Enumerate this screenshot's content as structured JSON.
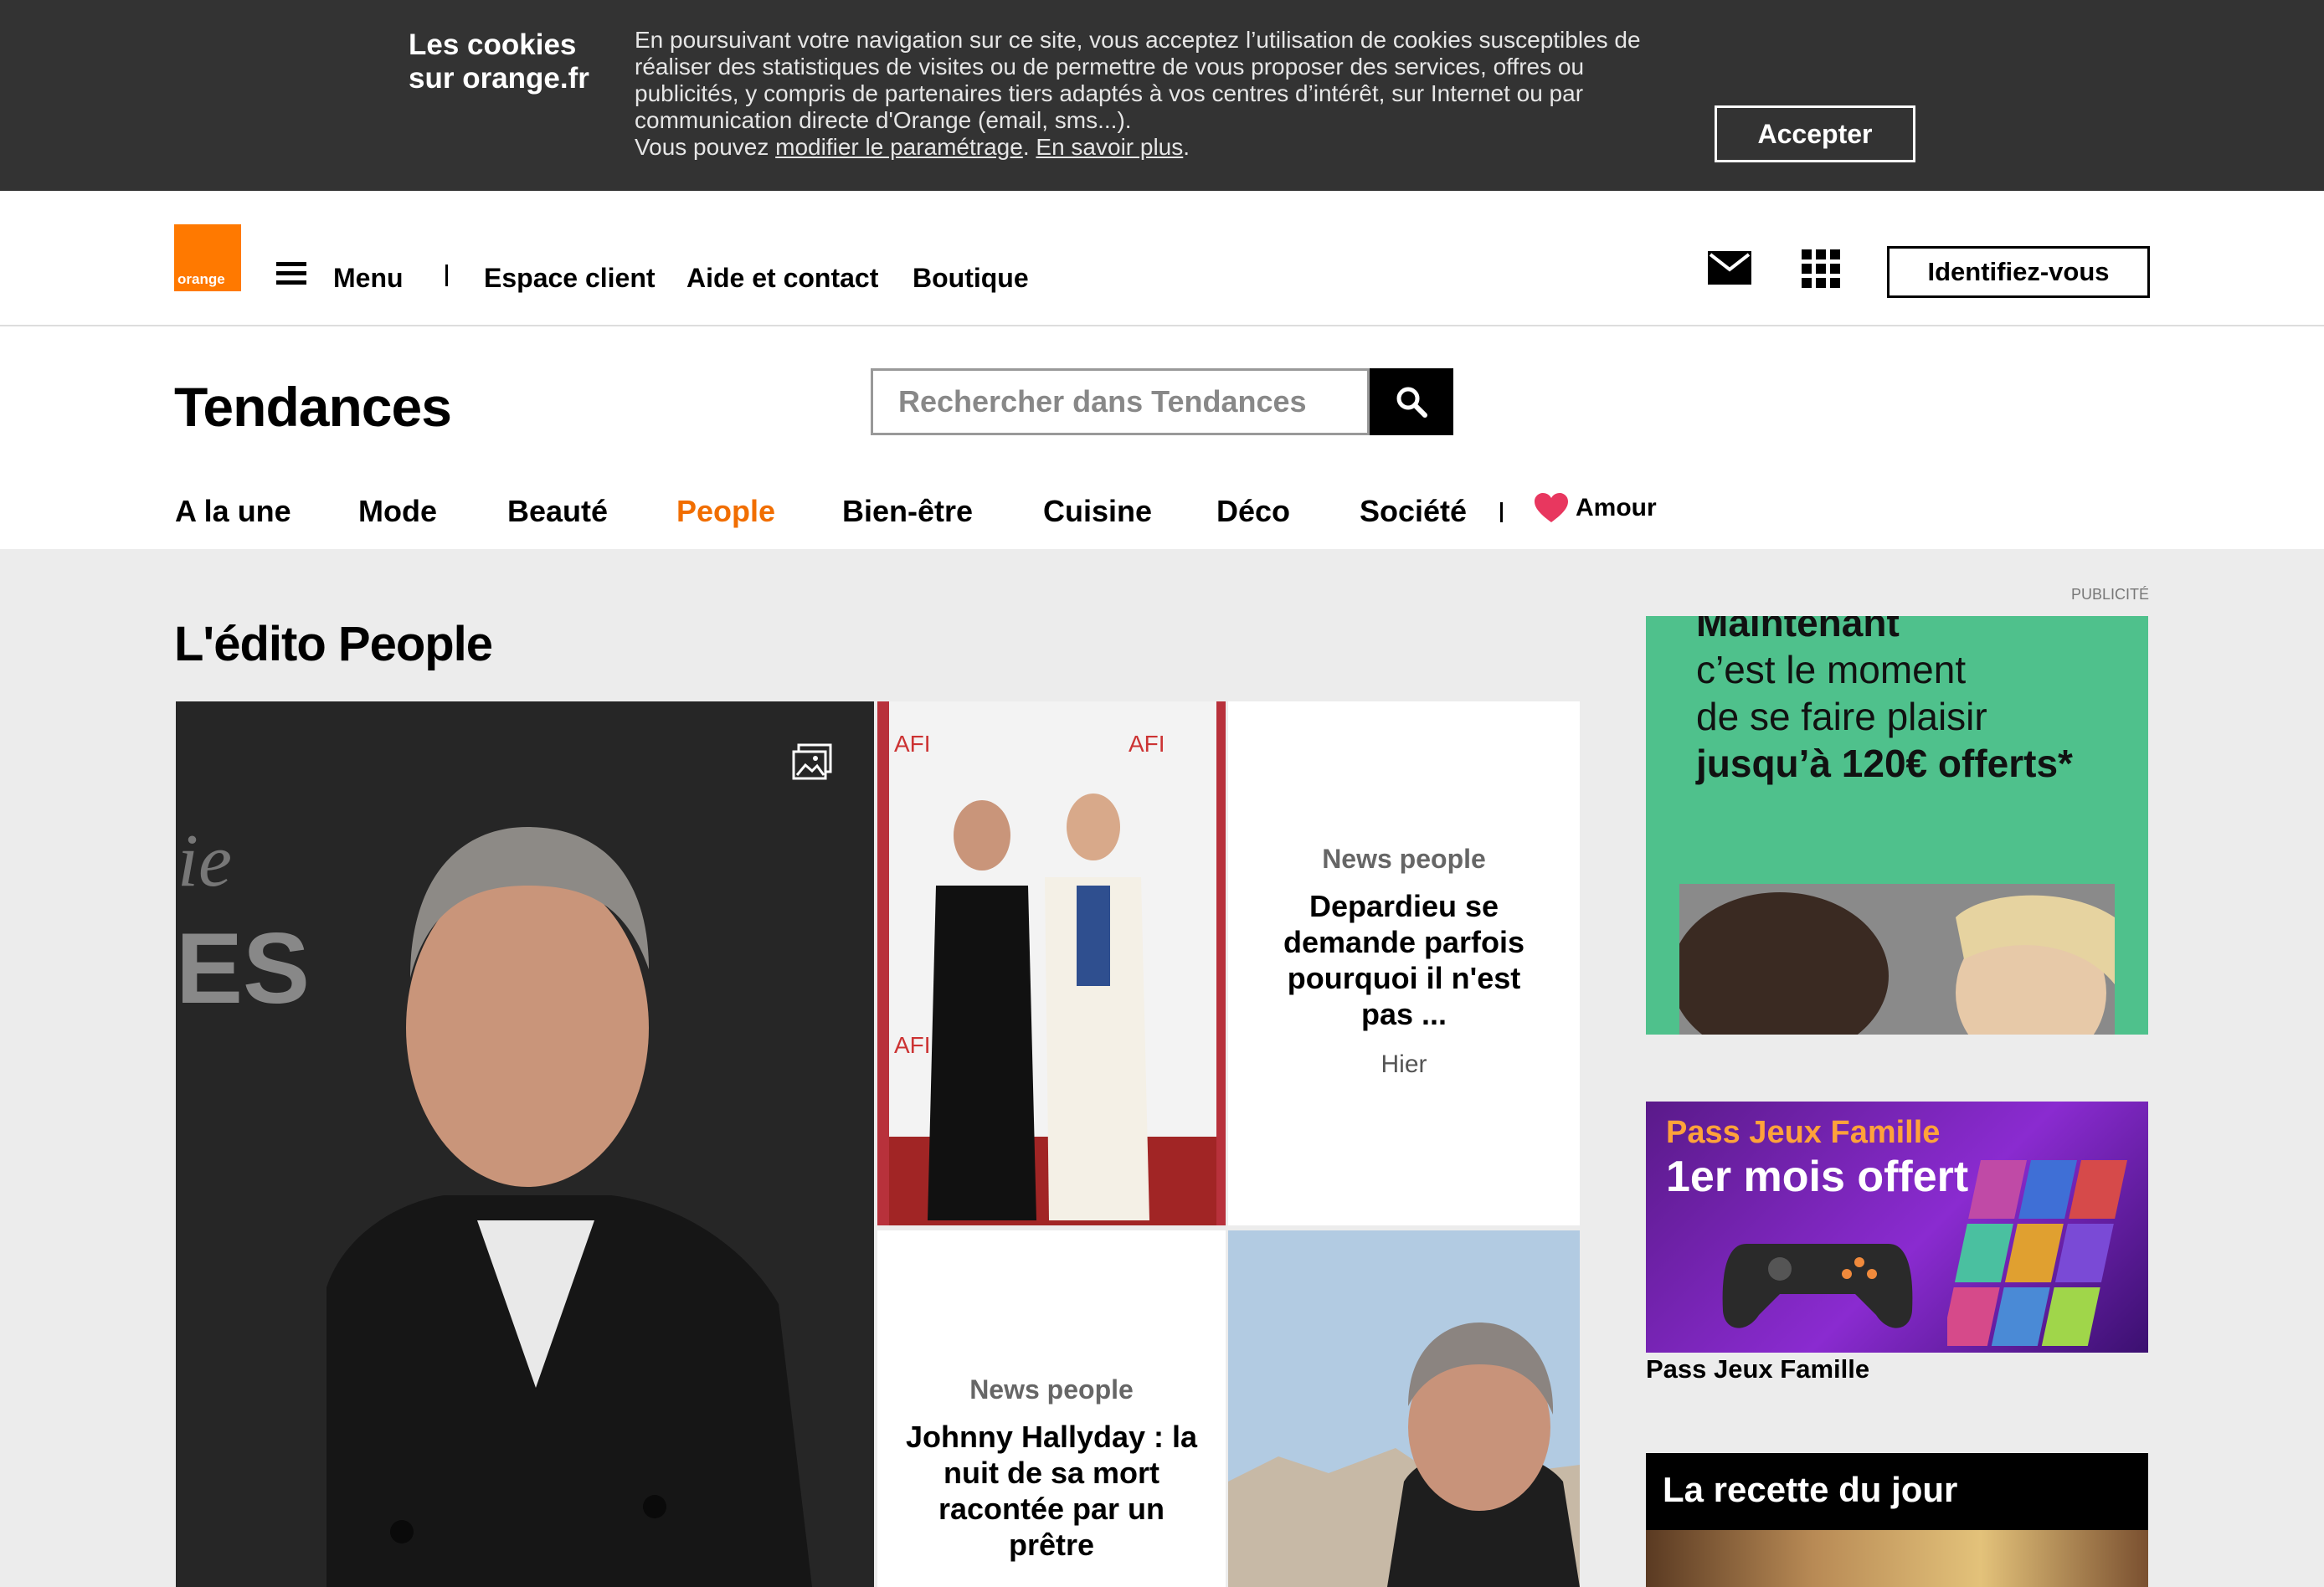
{
  "cookie_banner": {
    "title": "Les cookies sur orange.fr",
    "text": "En poursuivant votre navigation sur ce site, vous acceptez l’utilisation de cookies susceptibles de réaliser des statistiques de visites ou de permettre de vous proposer des services, offres ou publicités, y compris de partenaires tiers adaptés à vos centres d’intérêt, sur Internet ou par communication directe d'Orange (email, sms...).",
    "text_prefix": "Vous pouvez",
    "link_settings": "modifier le paramétrage",
    "link_more": "En savoir plus",
    "accept_label": "Accepter"
  },
  "header": {
    "logo_text": "orange",
    "menu_label": "Menu",
    "links": [
      "Espace client",
      "Aide et contact",
      "Boutique"
    ],
    "login_label": "Identifiez-vous"
  },
  "section": {
    "title": "Tendances",
    "search_placeholder": "Rechercher dans Tendances",
    "categories": [
      "A la une",
      "Mode",
      "Beauté",
      "People",
      "Bien-être",
      "Cuisine",
      "Déco",
      "Société"
    ],
    "active_category": "People",
    "amour_label": "Amour"
  },
  "main": {
    "edito_title": "L'édito People",
    "cards": [
      {
        "category": "News people",
        "title": "Depardieu se demande parfois pourquoi il n'est pas ...",
        "time": "Hier"
      },
      {
        "category": "News people",
        "title": "Johnny Hallyday : la nuit de sa mort racontée par un prêtre"
      }
    ]
  },
  "sidebar": {
    "pub_label": "PUBLICITÉ",
    "ad1_lines": [
      "Maintenant",
      "c’est le moment",
      "de se faire plaisir",
      "jusqu’à 120€ offerts*"
    ],
    "ad2_title": "Pass Jeux Famille",
    "ad2_offer": "1er mois offert",
    "ad2_caption": "Pass Jeux Famille",
    "recipe_title": "La recette du jour"
  },
  "colors": {
    "orange": "#ff7900",
    "active": "#f16e00",
    "banner": "#333333"
  }
}
